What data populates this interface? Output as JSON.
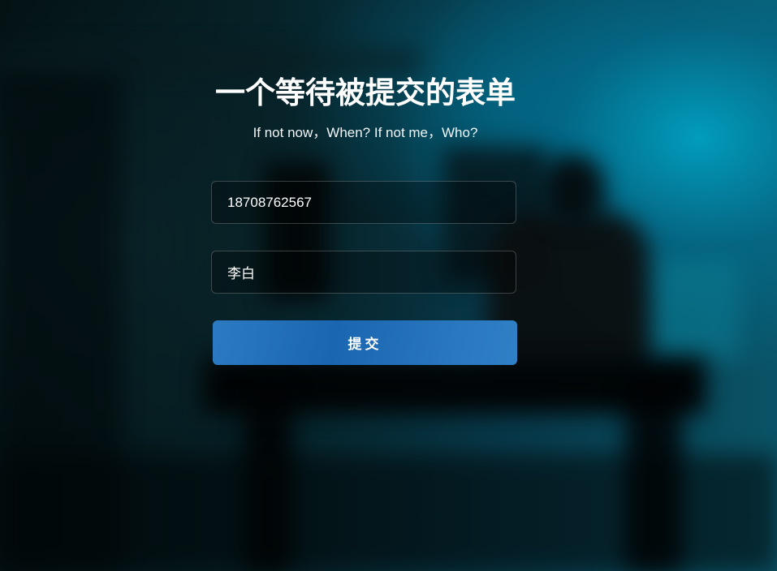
{
  "form": {
    "title": "一个等待被提交的表单",
    "subtitle": "If not now，When? If not me，Who?",
    "phone_value": "18708762567",
    "name_value": "李白",
    "submit_label": "提交"
  },
  "colors": {
    "button_accent": "#1a66b0",
    "background_teal": "#0a5366",
    "text": "#ffffff"
  }
}
